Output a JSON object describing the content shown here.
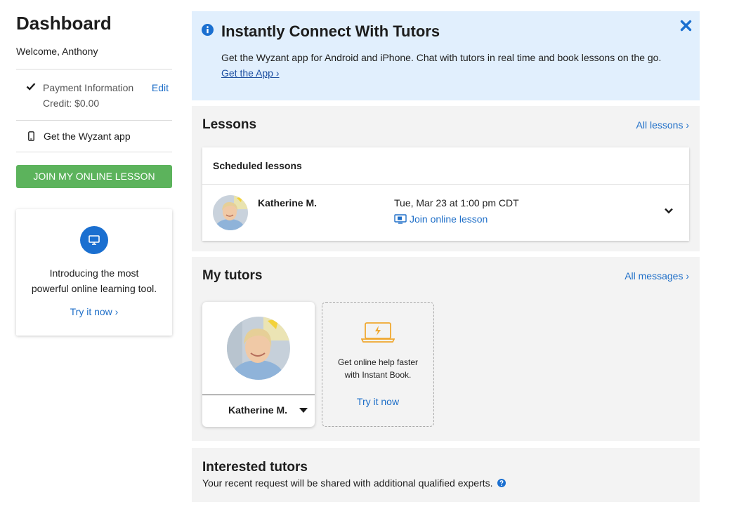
{
  "sidebar": {
    "title": "Dashboard",
    "welcome": "Welcome, Anthony",
    "payment": {
      "label": "Payment Information",
      "credit": "Credit: $0.00",
      "edit": "Edit"
    },
    "app_link": "Get the Wyzant app",
    "join_button": "JOIN MY ONLINE LESSON",
    "promo": {
      "text_line1": "Introducing the most",
      "text_line2": "powerful online learning tool.",
      "link": "Try it now ›"
    }
  },
  "banner": {
    "title": "Instantly Connect With Tutors",
    "text": "Get the Wyzant app for Android and iPhone. Chat with tutors in real time and book lessons on the go.",
    "link": "Get the App ›"
  },
  "lessons": {
    "title": "Lessons",
    "all_link": "All lessons ›",
    "scheduled_header": "Scheduled lessons",
    "items": [
      {
        "tutor": "Katherine M.",
        "datetime": "Tue, Mar 23 at 1:00 pm CDT",
        "join": "Join online lesson"
      }
    ]
  },
  "tutors": {
    "title": "My tutors",
    "all_link": "All messages ›",
    "cards": [
      {
        "name": "Katherine M."
      }
    ],
    "instant": {
      "line1": "Get online help faster",
      "line2": "with Instant Book.",
      "link": "Try it now"
    }
  },
  "interested": {
    "title": "Interested tutors",
    "text": "Your recent request will be shared with additional qualified experts."
  },
  "colors": {
    "accent": "#1f6fc8",
    "join_green": "#5cb35c",
    "banner_bg": "#e1effd",
    "section_bg": "#f3f3f3",
    "instant_orange": "#f0a830"
  }
}
